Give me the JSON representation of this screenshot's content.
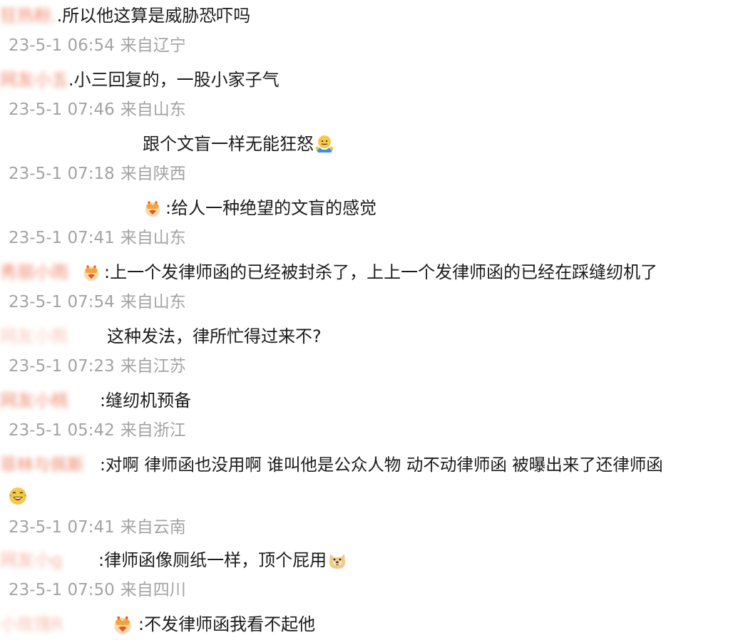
{
  "comments": [
    {
      "user": "狂热粉.",
      "text": ".所以他这算是威胁恐吓吗",
      "date": "23-5-1 06:54",
      "location": "来自辽宁"
    },
    {
      "user": "网友小五",
      "text": ".小三回复的，一股小家子气",
      "date": "23-5-1 07:46",
      "location": "来自山东"
    },
    {
      "user": "",
      "text": "跟个文盲一样无能狂怒",
      "date": "23-5-1 07:18",
      "location": "来自陕西"
    },
    {
      "user": "",
      "text": ":给人一种绝望的文盲的感觉",
      "date": "23-5-1 07:41",
      "location": "来自山东"
    },
    {
      "user": "秀丽小雨",
      "text": ":上一个发律师函的已经被封杀了，上上一个发律师函的已经在踩缝纫机了",
      "date": "23-5-1 07:54",
      "location": "来自山东"
    },
    {
      "user": "网友小熊",
      "text": "这种发法，律所忙得过来不?",
      "date": "23-5-1 07:23",
      "location": "来自江苏"
    },
    {
      "user": "网友小桃",
      "text": ":缝纫机预备",
      "date": "23-5-1 05:42",
      "location": "来自浙江"
    },
    {
      "user": "菲林与佩斯",
      "text": ":对啊 律师函也没用啊 谁叫他是公众人物 动不动律师函 被曝出来了还律师函",
      "date": "23-5-1 07:41",
      "location": "来自云南"
    },
    {
      "user": "网友小g",
      "text": ":律师函像厕纸一样，顶个屁用",
      "date": "23-5-1 07:50",
      "location": "来自四川"
    },
    {
      "user": "小玫瑰R",
      "text": ":不发律师函我看不起他"
    }
  ],
  "icons": {
    "crown_badge": "crown-badge-icon",
    "shrug_emoji": "shrug-emoji",
    "laugh_emoji": "laughing-tears-emoji",
    "doge_emoji": "doge-emoji"
  },
  "colors": {
    "text": "#1b1b1b",
    "meta": "#a3a3a3",
    "username": "#eb7350",
    "crown": "#f2a43a"
  }
}
